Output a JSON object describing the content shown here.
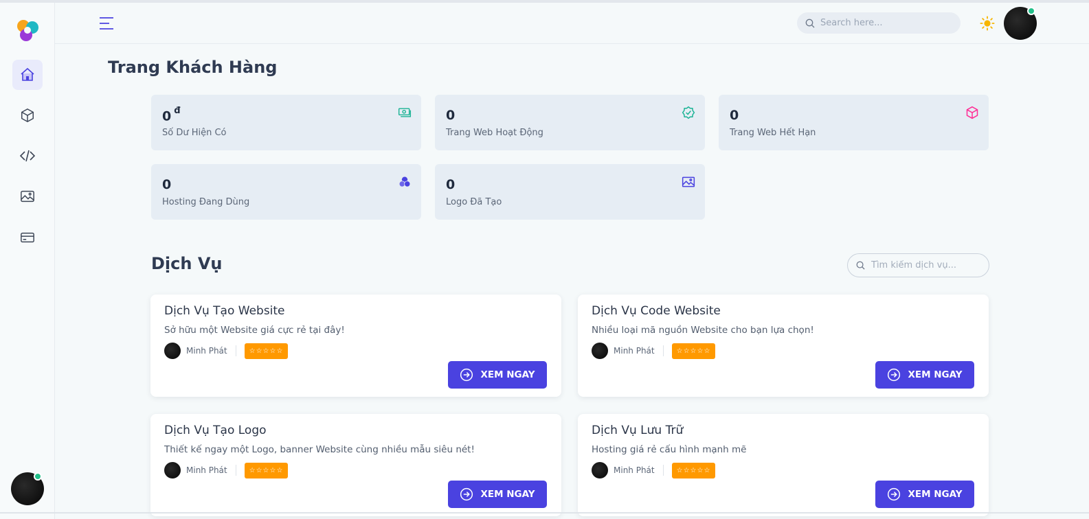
{
  "header": {
    "search_placeholder": "Search here...",
    "icons": [
      "menu-icon",
      "search-icon",
      "sun-icon",
      "avatar"
    ]
  },
  "sidebar": {
    "items": [
      {
        "icon": "home-icon",
        "active": true
      },
      {
        "icon": "cube-icon",
        "active": false
      },
      {
        "icon": "code-icon",
        "active": false
      },
      {
        "icon": "image-icon",
        "active": false
      },
      {
        "icon": "credit-card-icon",
        "active": false
      }
    ]
  },
  "page": {
    "title": "Trang Khách Hàng"
  },
  "stats": [
    {
      "value": "0",
      "unit": "đ",
      "label": "Số Dư Hiện Có",
      "icon": "money-icon",
      "color": "#1ab394"
    },
    {
      "value": "0",
      "label": "Trang Web Hoạt Động",
      "icon": "check-badge-icon",
      "color": "#1ab394"
    },
    {
      "value": "0",
      "label": "Trang Web Hết Hạn",
      "icon": "cube-icon",
      "color": "#ff2d95"
    },
    {
      "value": "0",
      "label": "Hosting Đang Dùng",
      "icon": "circles-icon",
      "color": "#4a42e0"
    },
    {
      "value": "0",
      "label": "Logo Đã Tạo",
      "icon": "image-icon",
      "color": "#4a42e0"
    }
  ],
  "services_section": {
    "title": "Dịch Vụ",
    "search_placeholder": "Tìm kiếm dịch vụ..."
  },
  "services": [
    {
      "title": "Dịch Vụ Tạo Website",
      "description": "Sở hữu một Website giá cực rẻ tại đây!",
      "author": "Minh Phát",
      "rating": "☆☆☆☆☆",
      "button": "XEM NGAY"
    },
    {
      "title": "Dịch Vụ Code Website",
      "description": "Nhiều loại mã nguồn Website cho bạn lựa chọn!",
      "author": "Minh Phát",
      "rating": "☆☆☆☆☆",
      "button": "XEM NGAY"
    },
    {
      "title": "Dịch Vụ Tạo Logo",
      "description": "Thiết kế ngay một Logo, banner Website cùng nhiều mẫu siêu nét!",
      "author": "Minh Phát",
      "rating": "☆☆☆☆☆",
      "button": "XEM NGAY"
    },
    {
      "title": "Dịch Vụ Lưu Trữ",
      "description": "Hosting giá rẻ cấu hình mạnh mẽ",
      "author": "Minh Phát",
      "rating": "☆☆☆☆☆",
      "button": "XEM NGAY"
    }
  ],
  "colors": {
    "accent": "#4a42e0",
    "rating": "#ff9900",
    "online": "#22c08a",
    "card_bg": "#e6edf4"
  }
}
